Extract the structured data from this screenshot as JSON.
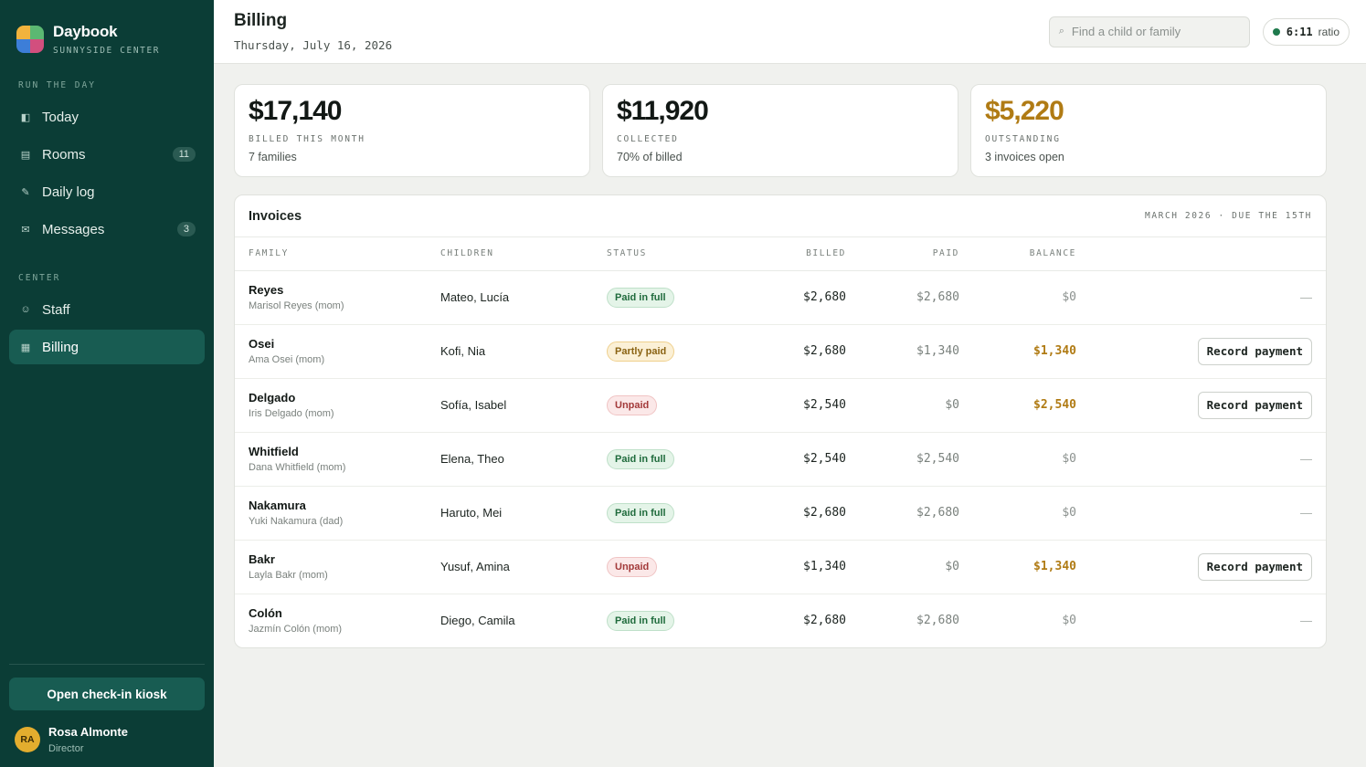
{
  "brand": {
    "name": "Daybook",
    "subtitle": "SUNNYSIDE CENTER"
  },
  "sidebar": {
    "sections": [
      {
        "label": "RUN THE DAY"
      },
      {
        "label": "CENTER"
      }
    ],
    "items": [
      {
        "label": "Today",
        "icon": "◧",
        "badge": ""
      },
      {
        "label": "Rooms",
        "icon": "▤",
        "badge": "11"
      },
      {
        "label": "Daily log",
        "icon": "✎",
        "badge": ""
      },
      {
        "label": "Messages",
        "icon": "✉",
        "badge": "3"
      },
      {
        "label": "Staff",
        "icon": "☺",
        "badge": ""
      },
      {
        "label": "Billing",
        "icon": "▦",
        "badge": "",
        "active": true
      }
    ],
    "kiosk_label": "Open check-in kiosk",
    "user": {
      "initials": "RA",
      "name": "Rosa Almonte",
      "role": "Director"
    }
  },
  "header": {
    "title": "Billing",
    "date": "Thursday, July 16, 2026",
    "search_placeholder": "Find a child or family",
    "search_icon": "⌕",
    "ratio_value": "6:11",
    "ratio_label": "ratio"
  },
  "stats": [
    {
      "value": "$17,140",
      "label": "BILLED THIS MONTH",
      "sub": "7 families"
    },
    {
      "value": "$11,920",
      "label": "COLLECTED",
      "sub": "70% of billed"
    },
    {
      "value": "$5,220",
      "label": "OUTSTANDING",
      "sub": "3 invoices open"
    }
  ],
  "invoices": {
    "title": "Invoices",
    "period": "MARCH 2026 · DUE THE 15TH",
    "columns": {
      "family": "FAMILY",
      "children": "CHILDREN",
      "status": "STATUS",
      "billed": "BILLED",
      "paid": "PAID",
      "balance": "BALANCE"
    },
    "action_label": "Record payment",
    "empty_action": "—",
    "rows": [
      {
        "family": "Reyes",
        "contact": "Marisol Reyes (mom)",
        "children": "Mateo, Lucía",
        "status": "Paid in full",
        "billed": "$2,680",
        "paid": "$2,680",
        "balance": "$0"
      },
      {
        "family": "Osei",
        "contact": "Ama Osei (mom)",
        "children": "Kofi, Nia",
        "status": "Partly paid",
        "billed": "$2,680",
        "paid": "$1,340",
        "balance": "$1,340"
      },
      {
        "family": "Delgado",
        "contact": "Iris Delgado (mom)",
        "children": "Sofía, Isabel",
        "status": "Unpaid",
        "billed": "$2,540",
        "paid": "$0",
        "balance": "$2,540"
      },
      {
        "family": "Whitfield",
        "contact": "Dana Whitfield (mom)",
        "children": "Elena, Theo",
        "status": "Paid in full",
        "billed": "$2,540",
        "paid": "$2,540",
        "balance": "$0"
      },
      {
        "family": "Nakamura",
        "contact": "Yuki Nakamura (dad)",
        "children": "Haruto, Mei",
        "status": "Paid in full",
        "billed": "$2,680",
        "paid": "$2,680",
        "balance": "$0"
      },
      {
        "family": "Bakr",
        "contact": "Layla Bakr (mom)",
        "children": "Yusuf, Amina",
        "status": "Unpaid",
        "billed": "$1,340",
        "paid": "$0",
        "balance": "$1,340"
      },
      {
        "family": "Colón",
        "contact": "Jazmín Colón (mom)",
        "children": "Diego, Camila",
        "status": "Paid in full",
        "billed": "$2,680",
        "paid": "$2,680",
        "balance": "$0"
      }
    ]
  },
  "colors": {
    "sidebar_bg": "#0b3d36",
    "active_nav": "#185c52",
    "accent_warn": "#b07b14",
    "paid_green": "#1f6b3c",
    "unpaid_red": "#a33a3a"
  }
}
